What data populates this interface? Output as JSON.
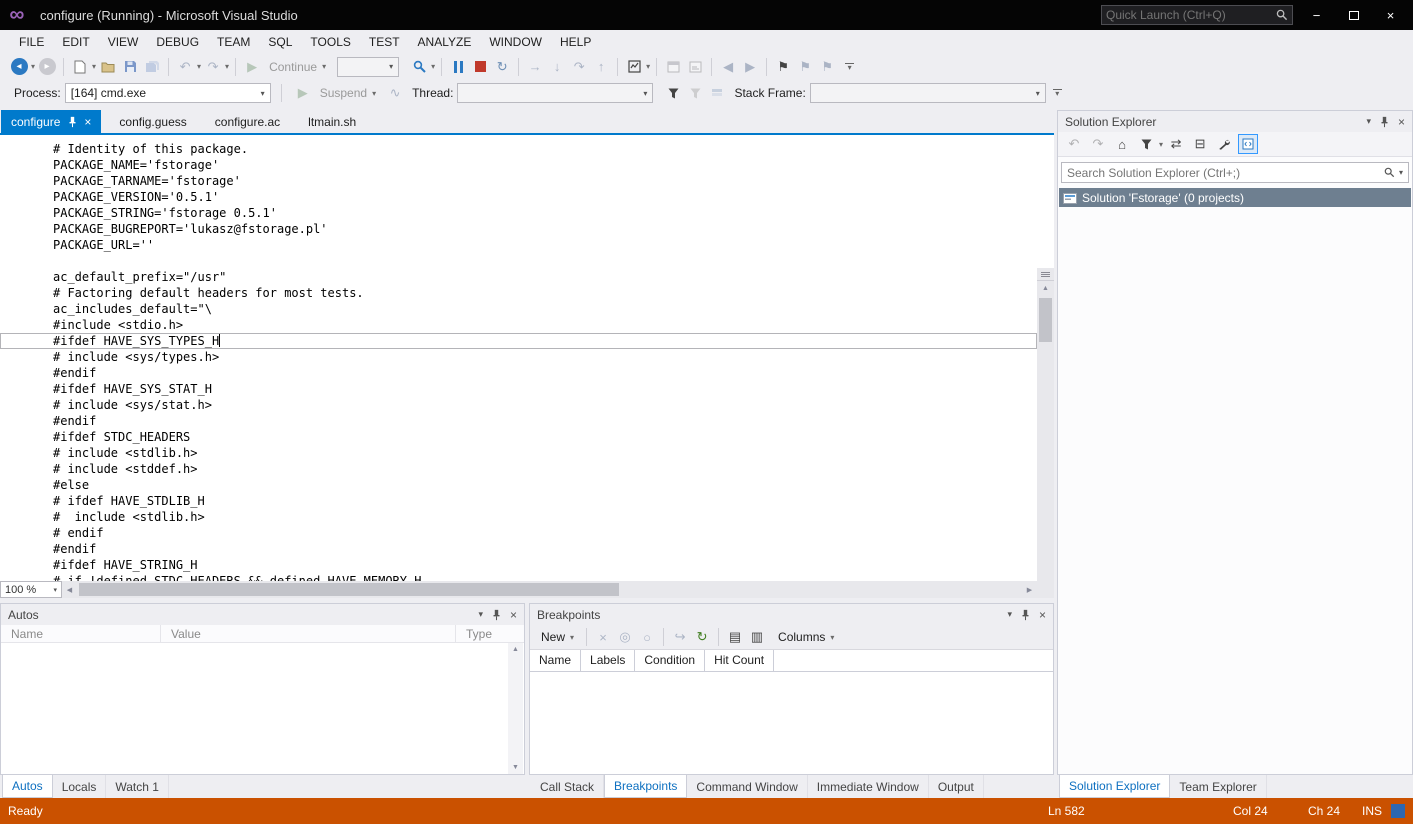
{
  "titlebar": {
    "title": "configure (Running) - Microsoft Visual Studio",
    "quick_launch_placeholder": "Quick Launch (Ctrl+Q)"
  },
  "menu": [
    "FILE",
    "EDIT",
    "VIEW",
    "DEBUG",
    "TEAM",
    "SQL",
    "TOOLS",
    "TEST",
    "ANALYZE",
    "WINDOW",
    "HELP"
  ],
  "toolbar": {
    "continue_label": "Continue",
    "process_label": "Process:",
    "process_value": "[164] cmd.exe",
    "suspend_label": "Suspend",
    "thread_label": "Thread:",
    "stack_frame_label": "Stack Frame:"
  },
  "doc_tabs": [
    {
      "label": "configure",
      "active": true
    },
    {
      "label": "config.guess"
    },
    {
      "label": "configure.ac"
    },
    {
      "label": "ltmain.sh"
    }
  ],
  "editor": {
    "zoom": "100 %",
    "lines": [
      {
        "t": "# Identity of this package."
      },
      {
        "t": "PACKAGE_NAME='fstorage'"
      },
      {
        "t": "PACKAGE_TARNAME='fstorage'"
      },
      {
        "t": "PACKAGE_VERSION='0.5.1'"
      },
      {
        "t": "PACKAGE_STRING='fstorage 0.5.1'"
      },
      {
        "t": "PACKAGE_BUGREPORT='lukasz@fstorage.pl'"
      },
      {
        "t": "PACKAGE_URL=''"
      },
      {
        "t": ""
      },
      {
        "t": "ac_default_prefix=\"/usr\""
      },
      {
        "t": "# Factoring default headers for most tests."
      },
      {
        "t": "ac_includes_default=\"\\"
      },
      {
        "t": "#include <stdio.h>"
      },
      {
        "t": "#ifdef HAVE_SYS_TYPES_H",
        "current": true
      },
      {
        "t": "# include <sys/types.h>"
      },
      {
        "t": "#endif"
      },
      {
        "t": "#ifdef HAVE_SYS_STAT_H"
      },
      {
        "t": "# include <sys/stat.h>"
      },
      {
        "t": "#endif"
      },
      {
        "t": "#ifdef STDC_HEADERS"
      },
      {
        "t": "# include <stdlib.h>"
      },
      {
        "t": "# include <stddef.h>"
      },
      {
        "t": "#else"
      },
      {
        "t": "# ifdef HAVE_STDLIB_H"
      },
      {
        "t": "#  include <stdlib.h>"
      },
      {
        "t": "# endif"
      },
      {
        "t": "#endif"
      },
      {
        "t": "#ifdef HAVE_STRING_H"
      },
      {
        "t": "# if !defined STDC_HEADERS && defined HAVE_MEMORY_H"
      }
    ]
  },
  "solution_explorer": {
    "title": "Solution Explorer",
    "search_placeholder": "Search Solution Explorer (Ctrl+;)",
    "root_item": "Solution 'Fstorage' (0 projects)",
    "tabs": [
      {
        "label": "Solution Explorer",
        "active": true
      },
      {
        "label": "Team Explorer"
      }
    ]
  },
  "autos": {
    "title": "Autos",
    "columns": [
      "Name",
      "Value",
      "Type"
    ],
    "tabs": [
      {
        "label": "Autos",
        "active": true
      },
      {
        "label": "Locals"
      },
      {
        "label": "Watch 1"
      }
    ]
  },
  "breakpoints": {
    "title": "Breakpoints",
    "new_label": "New",
    "columns_label": "Columns",
    "columns": [
      "Name",
      "Labels",
      "Condition",
      "Hit Count"
    ],
    "tabs": [
      {
        "label": "Call Stack"
      },
      {
        "label": "Breakpoints",
        "active": true
      },
      {
        "label": "Command Window"
      },
      {
        "label": "Immediate Window"
      },
      {
        "label": "Output"
      }
    ]
  },
  "status": {
    "ready": "Ready",
    "line": "Ln 582",
    "column": "Col 24",
    "character": "Ch 24",
    "mode": "INS"
  },
  "icons": {
    "chevron_down": "▾",
    "close": "×",
    "minimize": "−",
    "up": "▲",
    "down": "▼",
    "left": "◀",
    "right": "▶",
    "back_circle": "◂",
    "forward_circle": "▸",
    "undo": "↶",
    "redo": "↷",
    "play": "▶",
    "restart": "↻",
    "next_statement": "→",
    "step_into": "↓",
    "step_over": "↷",
    "step_out": "↑",
    "flag": "⚑",
    "home": "⌂",
    "sync": "⇄",
    "collapse_all": "⊟",
    "thread": "∿",
    "toggle_all": "◎",
    "circle": "○",
    "goto_source": "↪",
    "goto_disassembly": "↻",
    "export": "↥",
    "import": "↧",
    "columns_a": "▤",
    "columns_b": "▥"
  },
  "colors": {
    "accent": "#007ACC",
    "titlebar": "#050505",
    "status_bar": "#CA5100",
    "selection": "#6E7F90",
    "stop_red": "#C0392B",
    "icon_blue": "#2B79C2"
  }
}
